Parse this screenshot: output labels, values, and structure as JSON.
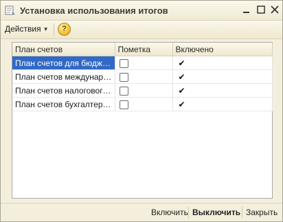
{
  "window": {
    "title": "Установка использования итогов"
  },
  "toolbar": {
    "actions_label": "Действия",
    "help_label": "?"
  },
  "table": {
    "columns": [
      "План счетов",
      "Пометка",
      "Включено"
    ],
    "rows": [
      {
        "name": "План счетов для бюджет...",
        "mark": false,
        "enabled": true,
        "selected": true
      },
      {
        "name": "План счетов международ...",
        "mark": false,
        "enabled": true,
        "selected": false
      },
      {
        "name": "План счетов налогового ...",
        "mark": false,
        "enabled": true,
        "selected": false
      },
      {
        "name": "План счетов бухгалтерск...",
        "mark": false,
        "enabled": true,
        "selected": false
      }
    ]
  },
  "footer": {
    "enable_label": "Включить",
    "disable_label": "Выключить",
    "close_label": "Закрыть"
  },
  "colors": {
    "selection": "#316ac5",
    "window_bg": "#f4efdc"
  }
}
